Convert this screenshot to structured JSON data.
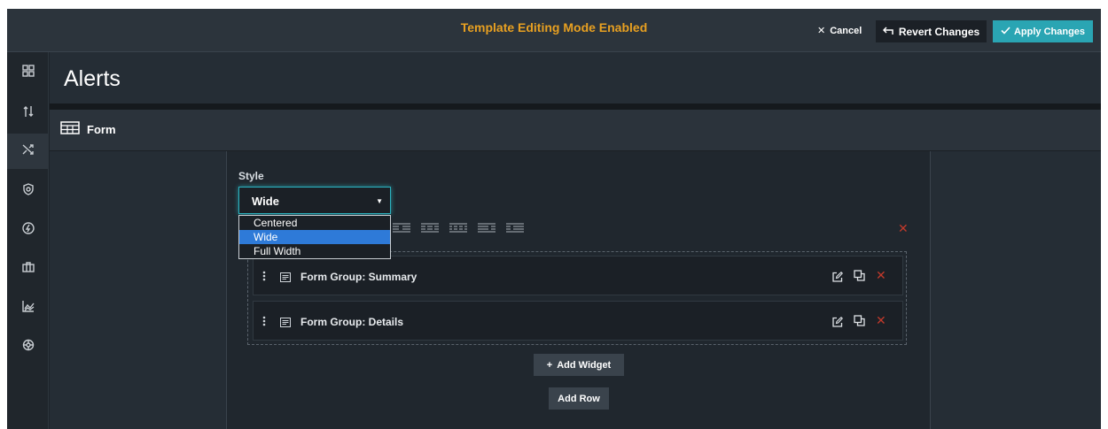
{
  "topbar": {
    "mode_title": "Template Editing Mode Enabled",
    "cancel_label": "Cancel",
    "revert_label": "Revert Changes",
    "apply_label": "Apply Changes"
  },
  "sidebar": {
    "items": [
      {
        "icon": "dashboard-icon",
        "active": false
      },
      {
        "icon": "sort-icon",
        "active": false
      },
      {
        "icon": "shuffle-icon",
        "active": true
      },
      {
        "icon": "shield-icon",
        "active": false
      },
      {
        "icon": "lightning-icon",
        "active": false
      },
      {
        "icon": "briefcase-icon",
        "active": false
      },
      {
        "icon": "chart-icon",
        "active": false
      },
      {
        "icon": "settings-icon",
        "active": false
      }
    ]
  },
  "page": {
    "title": "Alerts",
    "form_header": "Form"
  },
  "style_field": {
    "label": "Style",
    "value": "Wide",
    "options": [
      "Centered",
      "Wide",
      "Full Width"
    ],
    "selected_index": 1
  },
  "groups": [
    {
      "label": "Form Group: Summary"
    },
    {
      "label": "Form Group: Details"
    }
  ],
  "actions": {
    "add_widget": "Add Widget",
    "add_row": "Add Row"
  },
  "colors": {
    "accent": "#2aa5b3",
    "mode_title": "#e8a021",
    "delete": "#c0392b",
    "selected_option": "#2e7ad8"
  }
}
